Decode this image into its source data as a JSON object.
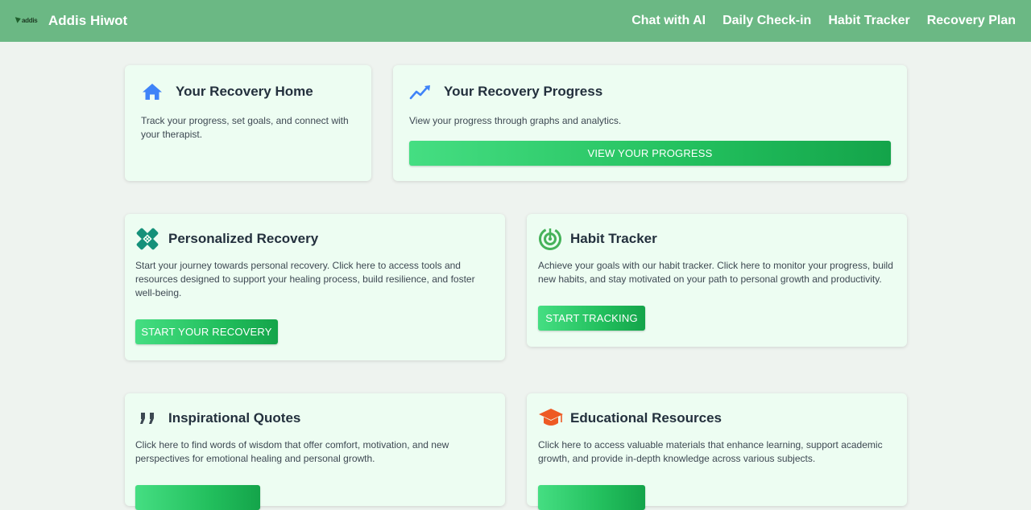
{
  "header": {
    "logo_text": "addis",
    "brand_name": "Addis Hiwot",
    "nav": [
      "Chat with AI",
      "Daily Check-in",
      "Habit Tracker",
      "Recovery Plan"
    ]
  },
  "cards": {
    "home": {
      "icon": "home-icon",
      "title": "Your Recovery Home",
      "description": "Track your progress, set goals, and connect with your therapist."
    },
    "progress": {
      "icon": "trend-line-icon",
      "title": "Your Recovery Progress",
      "description": "View your progress through graphs and analytics.",
      "button": "VIEW YOUR PROGRESS"
    },
    "personalized": {
      "icon": "bandage-icon",
      "title": "Personalized Recovery",
      "description": "Start your journey towards personal recovery. Click here to access tools and resources designed to support your healing process, build resilience, and foster well-being.",
      "button": "START YOUR RECOVERY"
    },
    "habit": {
      "icon": "target-icon",
      "title": "Habit Tracker",
      "description": "Achieve your goals with our habit tracker. Click here to monitor your progress, build new habits, and stay motivated on your path to personal growth and productivity.",
      "button": "START TRACKING"
    },
    "quotes": {
      "icon": "quote-icon",
      "title": "Inspirational Quotes",
      "description": "Click here to find words of wisdom that offer comfort, motivation, and new perspectives for emotional healing and personal growth."
    },
    "education": {
      "icon": "graduation-cap-icon",
      "title": "Educational Resources",
      "description": "Click here to access valuable materials that enhance learning, support academic growth, and provide in-depth knowledge across various subjects."
    }
  },
  "colors": {
    "navbar": "#6bb884",
    "background": "#eef3ef",
    "card": "#edfdf2",
    "button_start": "#45de82",
    "button_end": "#14a44a",
    "icon_blue": "#3f83f8",
    "icon_teal": "#15917a",
    "icon_green": "#46b25a",
    "icon_orange": "#ee5a24"
  }
}
